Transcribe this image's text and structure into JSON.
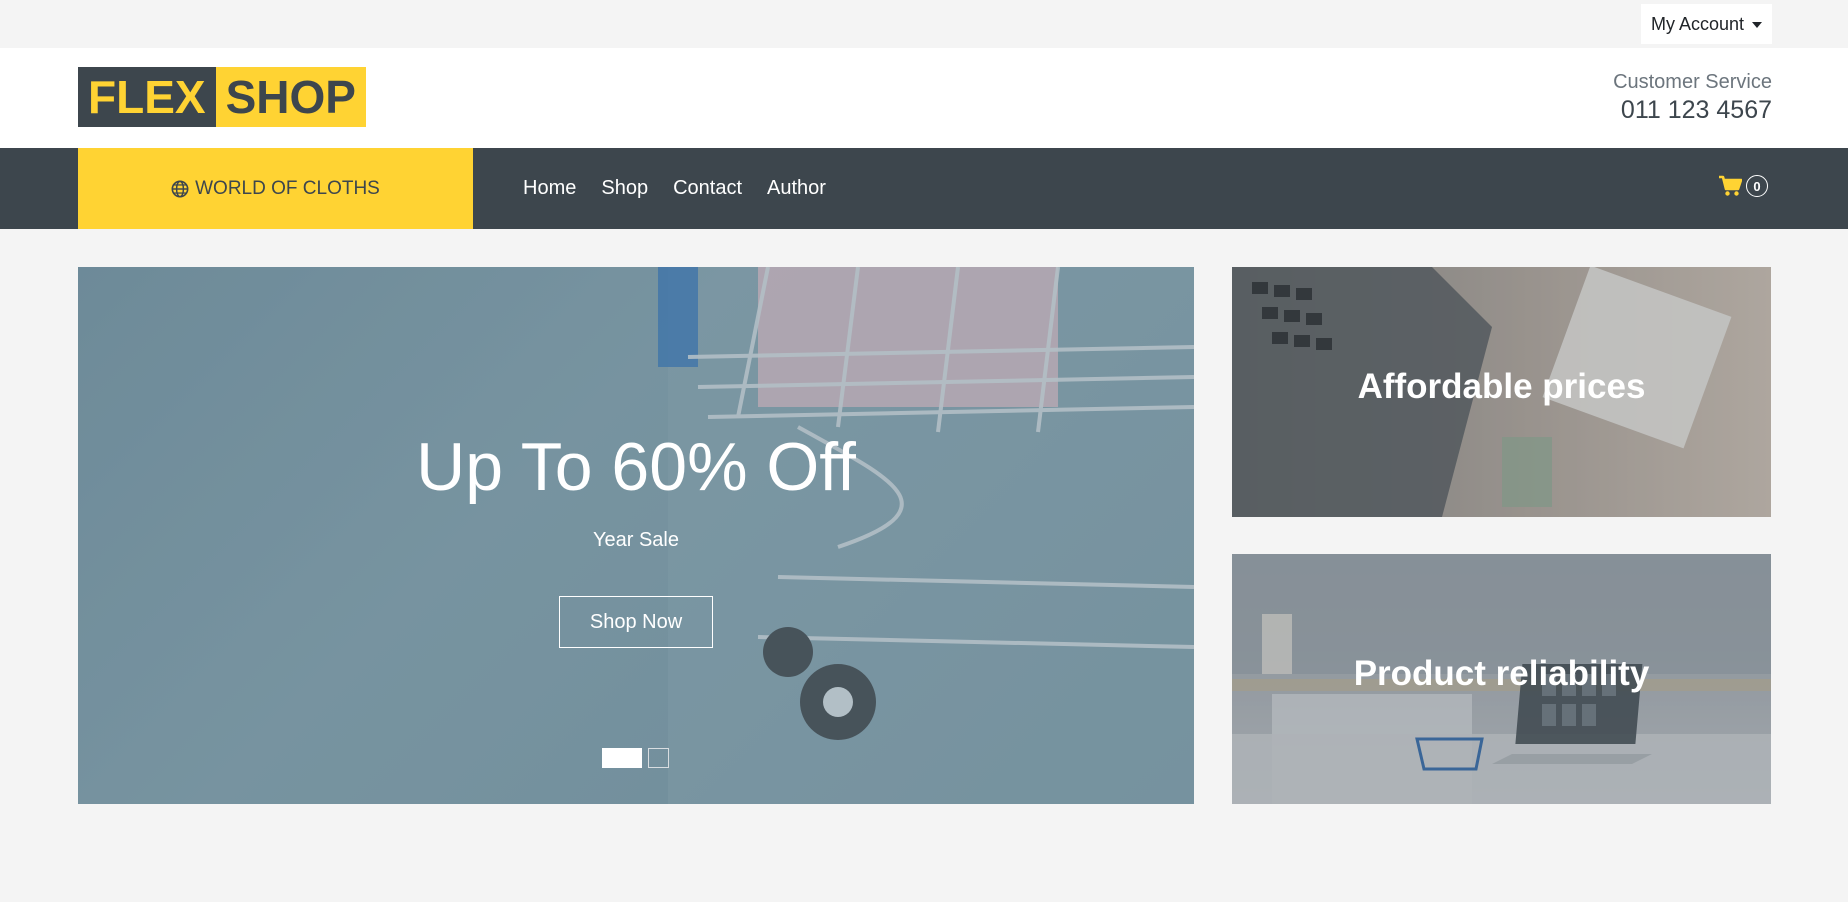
{
  "topbar": {
    "account_label": "My Account"
  },
  "header": {
    "logo_part1": "FLEX",
    "logo_part2": "SHOP",
    "customer_service_label": "Customer Service",
    "customer_service_phone": "011 123 4567"
  },
  "navbar": {
    "categories_label": "WORLD OF CLOTHS",
    "links": [
      "Home",
      "Shop",
      "Contact",
      "Author"
    ],
    "cart_count": "0"
  },
  "hero": {
    "title": "Up To 60% Off",
    "subtitle": "Year Sale",
    "button_label": "Shop Now",
    "slides_total": 2,
    "active_slide": 1
  },
  "promos": [
    {
      "label": "Affordable prices"
    },
    {
      "label": "Product reliability"
    }
  ],
  "colors": {
    "accent": "#ffd333",
    "dark": "#3d464d",
    "background": "#f4f4f4"
  },
  "icons": {
    "categories": "globe-icon",
    "cart": "shopping-cart-icon",
    "account_dropdown": "caret-down-icon"
  }
}
